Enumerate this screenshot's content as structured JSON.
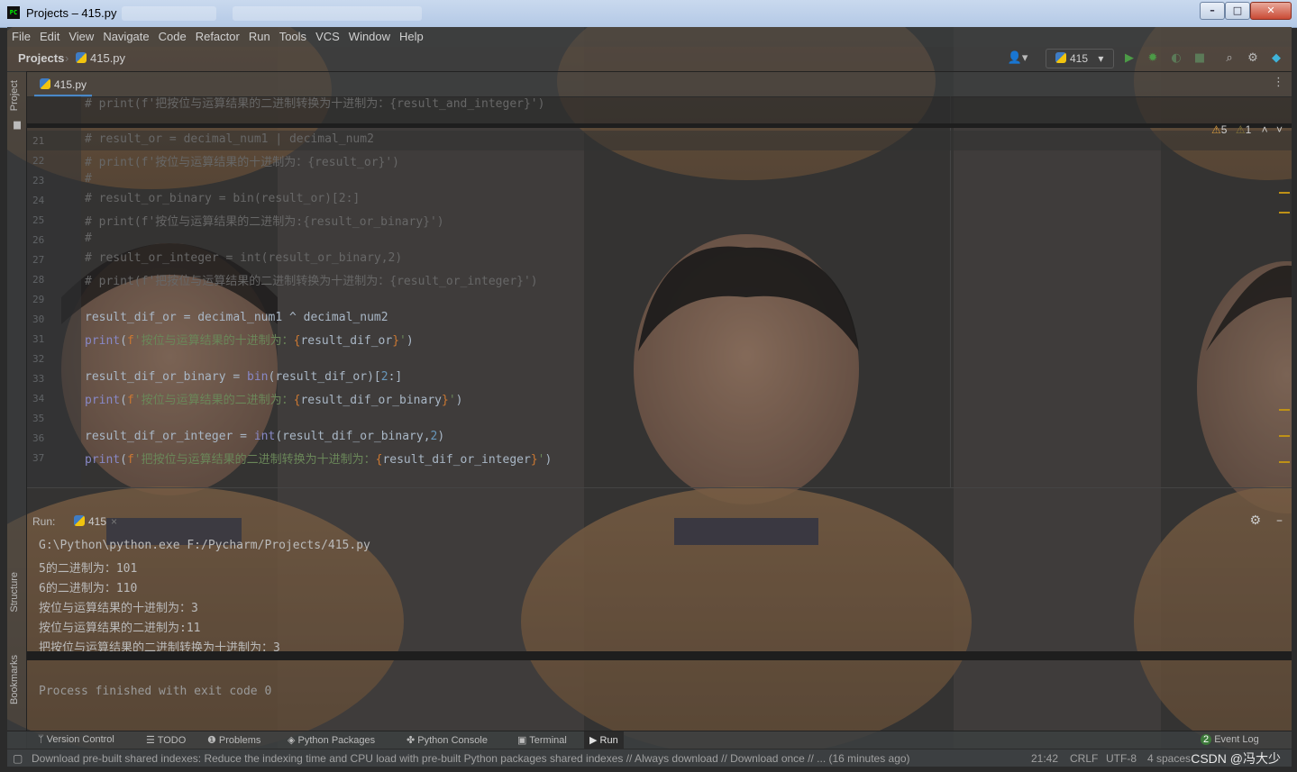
{
  "window": {
    "title": "Projects – 415.py"
  },
  "menu": [
    "File",
    "Edit",
    "View",
    "Navigate",
    "Code",
    "Refactor",
    "Run",
    "Tools",
    "VCS",
    "Window",
    "Help"
  ],
  "breadcrumb": {
    "project": "Projects",
    "file": "415.py"
  },
  "run_config": {
    "name": "415"
  },
  "left_tabs": {
    "project": "Project",
    "structure": "Structure",
    "bookmarks": "Bookmarks"
  },
  "editor_tab": {
    "name": "415.py"
  },
  "inspections": {
    "warnings": "5",
    "weak": "1"
  },
  "code": {
    "sticky": "# print(f'把按位与运算结果的二进制转换为十进制为：{result_and_integer}')",
    "lines": [
      {
        "n": "21",
        "kind": "cmt",
        "text": "# result_or = decimal_num1 | decimal_num2"
      },
      {
        "n": "22",
        "kind": "cmt",
        "text": "# print(f'按位与运算结果的十进制为：{result_or}')"
      },
      {
        "n": "23",
        "kind": "cmt",
        "text": "#"
      },
      {
        "n": "24",
        "kind": "cmt",
        "text": "# result_or_binary = bin(result_or)[2:]"
      },
      {
        "n": "25",
        "kind": "cmt",
        "text": "# print(f'按位与运算结果的二进制为:{result_or_binary}')"
      },
      {
        "n": "26",
        "kind": "cmt",
        "text": "#"
      },
      {
        "n": "27",
        "kind": "cmt",
        "text": "# result_or_integer = int(result_or_binary,2)"
      },
      {
        "n": "28",
        "kind": "cmt",
        "text": "# print(f'把按位与运算结果的二进制转换为十进制为：{result_or_integer}')"
      },
      {
        "n": "29",
        "kind": "blank",
        "text": ""
      },
      {
        "n": "30",
        "kind": "code",
        "text": "result_dif_or = decimal_num1 ^ decimal_num2"
      },
      {
        "n": "31",
        "kind": "code",
        "text": "print(f'按位与运算结果的十进制为：{result_dif_or}')"
      },
      {
        "n": "32",
        "kind": "blank",
        "text": ""
      },
      {
        "n": "33",
        "kind": "code",
        "text": "result_dif_or_binary = bin(result_dif_or)[2:]"
      },
      {
        "n": "34",
        "kind": "code",
        "text": "print(f'按位与运算结果的二进制为：{result_dif_or_binary}')"
      },
      {
        "n": "35",
        "kind": "blank",
        "text": ""
      },
      {
        "n": "36",
        "kind": "code",
        "text": "result_dif_or_integer = int(result_dif_or_binary,2)"
      },
      {
        "n": "37",
        "kind": "code",
        "text": "print(f'把按位与运算结果的二进制转换为十进制为：{result_dif_or_integer}')"
      }
    ]
  },
  "run": {
    "label": "Run:",
    "tab": "415",
    "output": [
      "G:\\Python\\python.exe F:/Pycharm/Projects/415.py",
      "5的二进制为：101",
      "6的二进制为：110",
      "按位与运算结果的十进制为：3",
      "按位与运算结果的二进制为:11",
      "把按位与运算结果的二进制转换为十进制为：3"
    ],
    "exit": "Process finished with exit code 0"
  },
  "tool_windows": [
    "Version Control",
    "TODO",
    "Problems",
    "Python Packages",
    "Python Console",
    "Terminal",
    "Run"
  ],
  "event_log": {
    "count": "2",
    "label": "Event Log"
  },
  "status": {
    "message": "Download pre-built shared indexes: Reduce the indexing time and CPU load with pre-built Python packages shared indexes // Always download // Download once // ... (16 minutes ago)",
    "position": "21:42",
    "line_sep": "CRLF",
    "encoding": "UTF-8",
    "indent": "4 spaces",
    "watermark": "CSDN @冯大少"
  }
}
